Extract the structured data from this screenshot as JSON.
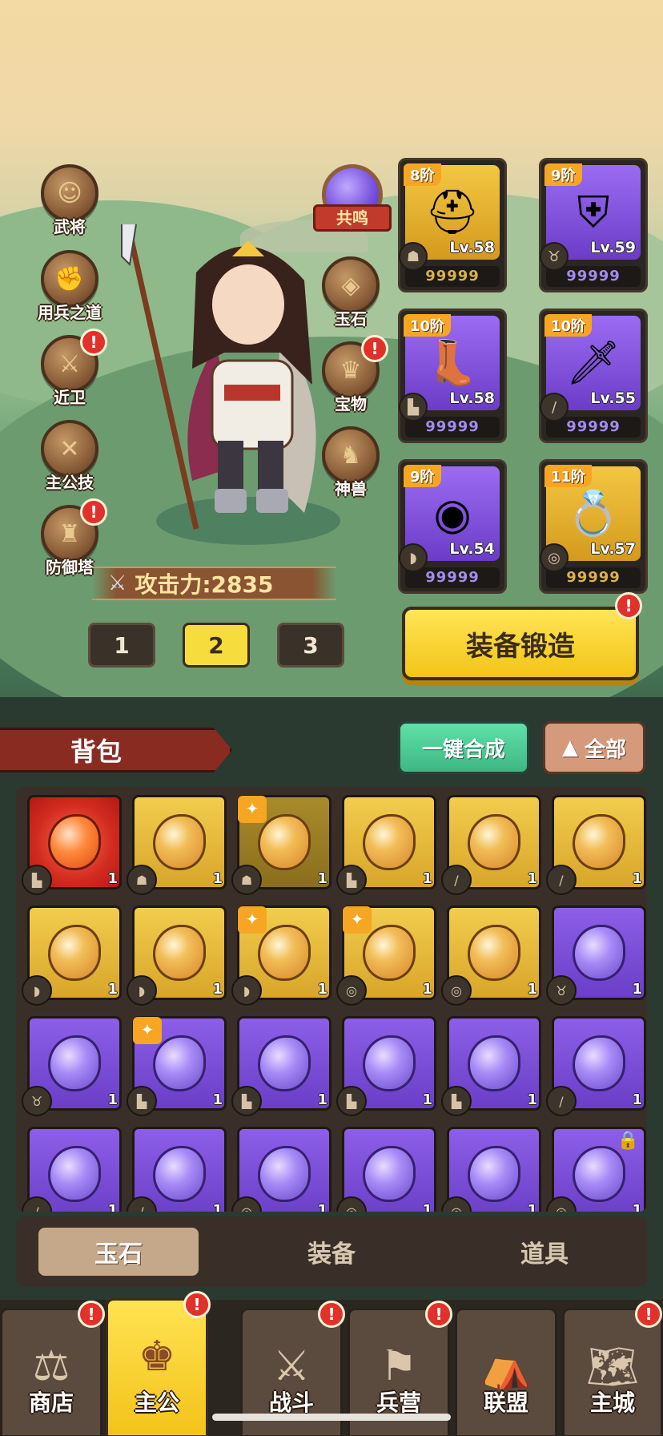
{
  "side_left": [
    {
      "label": "武将",
      "icon": "general-icon",
      "alert": false
    },
    {
      "label": "用兵之道",
      "icon": "tactics-icon",
      "alert": false
    },
    {
      "label": "近卫",
      "icon": "guard-icon",
      "alert": true
    },
    {
      "label": "主公技",
      "icon": "lord-skill-icon",
      "alert": false
    },
    {
      "label": "防御塔",
      "icon": "tower-icon",
      "alert": true
    }
  ],
  "side_right": {
    "resonate": "共鸣",
    "items": [
      {
        "label": "玉石",
        "icon": "jade-icon",
        "alert": false
      },
      {
        "label": "宝物",
        "icon": "treasure-icon",
        "alert": true
      },
      {
        "label": "神兽",
        "icon": "beast-icon",
        "alert": false
      }
    ]
  },
  "power": {
    "label": "攻击力:2835"
  },
  "loadout_tabs": [
    "1",
    "2",
    "3"
  ],
  "active_loadout": "2",
  "equipment": [
    {
      "tier": "8阶",
      "level": "Lv.58",
      "code": "99999",
      "rarity": "gold",
      "icon": "helmet-icon"
    },
    {
      "tier": "9阶",
      "level": "Lv.59",
      "code": "99999",
      "rarity": "purple",
      "icon": "armor-icon"
    },
    {
      "tier": "10阶",
      "level": "Lv.58",
      "code": "99999",
      "rarity": "purple",
      "icon": "boots-icon"
    },
    {
      "tier": "10阶",
      "level": "Lv.55",
      "code": "99999",
      "rarity": "purple",
      "icon": "sword-icon"
    },
    {
      "tier": "9阶",
      "level": "Lv.54",
      "code": "99999",
      "rarity": "purple",
      "icon": "bracer-icon"
    },
    {
      "tier": "11阶",
      "level": "Lv.57",
      "code": "99999",
      "rarity": "gold",
      "icon": "ring-icon"
    }
  ],
  "forge_button": "装备锻造",
  "bag": {
    "title": "背包",
    "merge_button": "一键合成",
    "filter_button": "全部",
    "items": [
      {
        "rarity": "red",
        "count": "1",
        "type": "boots",
        "spark": false,
        "lock": false
      },
      {
        "rarity": "gold",
        "count": "1",
        "type": "helmet",
        "spark": false,
        "lock": false
      },
      {
        "rarity": "dim",
        "count": "1",
        "type": "helmet",
        "spark": true,
        "lock": false
      },
      {
        "rarity": "gold",
        "count": "1",
        "type": "boots",
        "spark": false,
        "lock": false
      },
      {
        "rarity": "gold",
        "count": "1",
        "type": "sword",
        "spark": false,
        "lock": false
      },
      {
        "rarity": "gold",
        "count": "1",
        "type": "sword",
        "spark": false,
        "lock": false
      },
      {
        "rarity": "gold",
        "count": "1",
        "type": "bracer",
        "spark": false,
        "lock": false
      },
      {
        "rarity": "gold",
        "count": "1",
        "type": "bracer",
        "spark": false,
        "lock": false
      },
      {
        "rarity": "gold",
        "count": "1",
        "type": "bracer",
        "spark": true,
        "lock": false
      },
      {
        "rarity": "gold",
        "count": "1",
        "type": "ring",
        "spark": true,
        "lock": false
      },
      {
        "rarity": "gold",
        "count": "1",
        "type": "ring",
        "spark": false,
        "lock": false
      },
      {
        "rarity": "purple",
        "count": "1",
        "type": "armor",
        "spark": false,
        "lock": false
      },
      {
        "rarity": "purple",
        "count": "1",
        "type": "armor",
        "spark": false,
        "lock": false
      },
      {
        "rarity": "purple",
        "count": "1",
        "type": "boots",
        "spark": true,
        "lock": false
      },
      {
        "rarity": "purple",
        "count": "1",
        "type": "boots",
        "spark": false,
        "lock": false
      },
      {
        "rarity": "purple",
        "count": "1",
        "type": "boots",
        "spark": false,
        "lock": false
      },
      {
        "rarity": "purple",
        "count": "1",
        "type": "boots",
        "spark": false,
        "lock": false
      },
      {
        "rarity": "purple",
        "count": "1",
        "type": "sword",
        "spark": false,
        "lock": false
      },
      {
        "rarity": "purple",
        "count": "1",
        "type": "sword",
        "spark": false,
        "lock": false
      },
      {
        "rarity": "purple",
        "count": "1",
        "type": "sword",
        "spark": false,
        "lock": false
      },
      {
        "rarity": "purple",
        "count": "1",
        "type": "ring",
        "spark": false,
        "lock": false
      },
      {
        "rarity": "purple",
        "count": "1",
        "type": "ring",
        "spark": false,
        "lock": false
      },
      {
        "rarity": "purple",
        "count": "1",
        "type": "ring",
        "spark": false,
        "lock": false
      },
      {
        "rarity": "purple",
        "count": "1",
        "type": "ring",
        "spark": false,
        "lock": true
      }
    ],
    "categories": [
      "玉石",
      "装备",
      "道具"
    ],
    "active_category": "玉石"
  },
  "nav": [
    {
      "label": "商店",
      "icon": "shop-icon",
      "alert": true,
      "active": false
    },
    {
      "label": "主公",
      "icon": "lord-icon",
      "alert": true,
      "active": true
    },
    {
      "label": "战斗",
      "icon": "battle-icon",
      "alert": true,
      "active": false
    },
    {
      "label": "兵营",
      "icon": "barracks-icon",
      "alert": true,
      "active": false
    },
    {
      "label": "联盟",
      "icon": "alliance-icon",
      "alert": false,
      "active": false
    },
    {
      "label": "主城",
      "icon": "city-icon",
      "alert": true,
      "active": false
    }
  ],
  "colors": {
    "gold": "#f2c417",
    "purple": "#7b54e0",
    "alert": "#e2302a",
    "merge": "#3fb784"
  }
}
